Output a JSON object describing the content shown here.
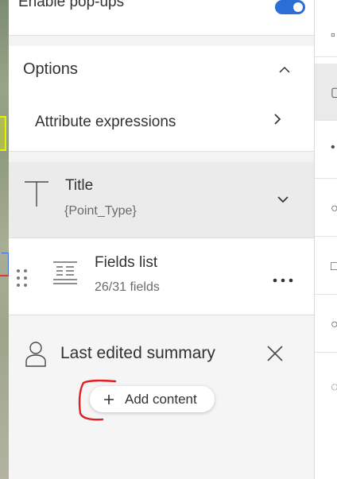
{
  "popups": {
    "label": "Enable pop-ups",
    "enabled": true,
    "accent": "#2a6ed6"
  },
  "options": {
    "label": "Options",
    "expanded": true,
    "attribute_expressions_label": "Attribute expressions"
  },
  "elements": {
    "title": {
      "label": "Title",
      "value": "{Point_Type}"
    },
    "fields_list": {
      "label": "Fields list",
      "count": "26/31 fields"
    },
    "last_edited": {
      "label": "Last edited summary"
    }
  },
  "add_content": {
    "label": "Add content"
  },
  "annotation": {
    "color": "#e02020"
  },
  "icons": {
    "chevron_up": "chevron-up-icon",
    "chevron_right": "chevron-right-icon",
    "chevron_down": "chevron-down-icon",
    "title": "text-title-icon",
    "fields": "fields-list-icon",
    "drag": "drag-handle-icon",
    "more": "more-horizontal-icon",
    "user": "user-icon",
    "close": "close-icon",
    "plus": "plus-icon"
  }
}
